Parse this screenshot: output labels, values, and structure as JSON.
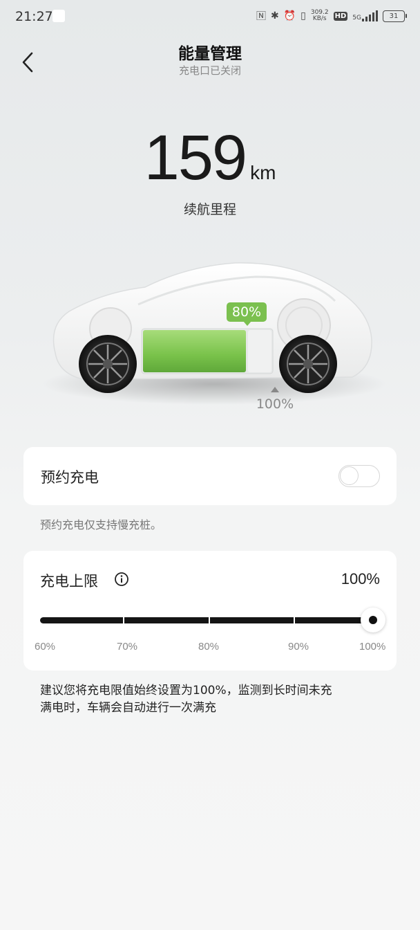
{
  "status_bar": {
    "time": "21:27",
    "net_speed_value": "309.2",
    "net_speed_unit": "KB/s",
    "hd_label": "HD",
    "network_label": "5G",
    "battery_level": "31"
  },
  "header": {
    "title": "能量管理",
    "subtitle": "充电口已关闭"
  },
  "range": {
    "value": "159",
    "unit": "km",
    "label": "续航里程"
  },
  "battery_visual": {
    "soc_label": "80%",
    "soc_fraction": 0.8,
    "limit_label": "100%",
    "fill_color": "#7bc04f"
  },
  "schedule_charging": {
    "label": "预约充电",
    "enabled": false,
    "note": "预约充电仅支持慢充桩。"
  },
  "charge_limit": {
    "title": "充电上限",
    "value": "100%",
    "slider_fraction": 1.0,
    "ticks": [
      "60%",
      "70%",
      "80%",
      "90%",
      "100%"
    ]
  },
  "advice_lines": [
    "建议您将充电限值始终设置为100%，监测到长时间未充",
    "满电时，车辆会自动进行一次满充"
  ]
}
